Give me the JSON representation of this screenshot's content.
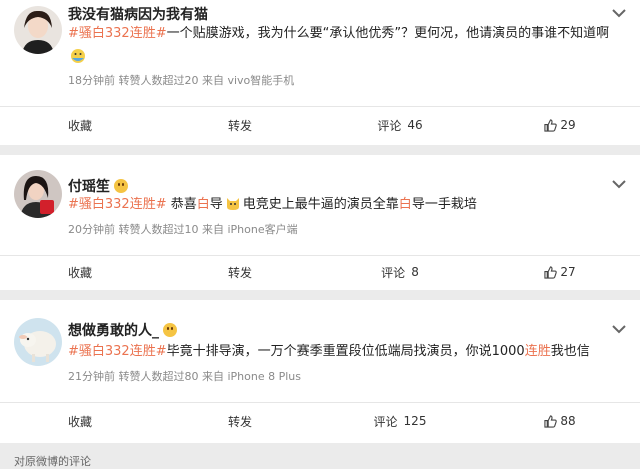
{
  "posts": [
    {
      "username": "我没有猫病因为我有猫",
      "hashtag": "#骚白332连胜#",
      "text": "一个贴膜游戏，我为什么要“承认他优秀”？更何况，他请演员的事谁不知道啊",
      "meta": "18分钟前  转赞人数超过20  来自 vivo智能手机",
      "actions": {
        "collect": "收藏",
        "repost": "转发",
        "comment": "评论",
        "comment_count": "46",
        "like_count": "29"
      }
    },
    {
      "username": "付瑶笙",
      "hashtag": "#骚白332连胜#",
      "text_a": " 恭喜",
      "hl_a": "白",
      "text_b": "导",
      "text_c": "电竞史上最牛逼的演员全靠",
      "hl_b": "白",
      "text_d": "导一手栽培",
      "meta": "20分钟前  转赞人数超过10  来自 iPhone客户端",
      "actions": {
        "collect": "收藏",
        "repost": "转发",
        "comment": "评论",
        "comment_count": "8",
        "like_count": "27"
      }
    },
    {
      "username": "想做勇敢的人_",
      "hashtag": "#骚白332连胜#",
      "text_a": "毕竟十排导演，一万个赛季重置段位低端局找演员，你说1000",
      "hl": "连胜",
      "text_b": "我也信",
      "meta": "21分钟前  转赞人数超过80  来自 iPhone 8 Plus",
      "actions": {
        "collect": "收藏",
        "repost": "转发",
        "comment": "评论",
        "comment_count": "125",
        "like_count": "88"
      }
    }
  ],
  "footer": "对原微博的评论"
}
